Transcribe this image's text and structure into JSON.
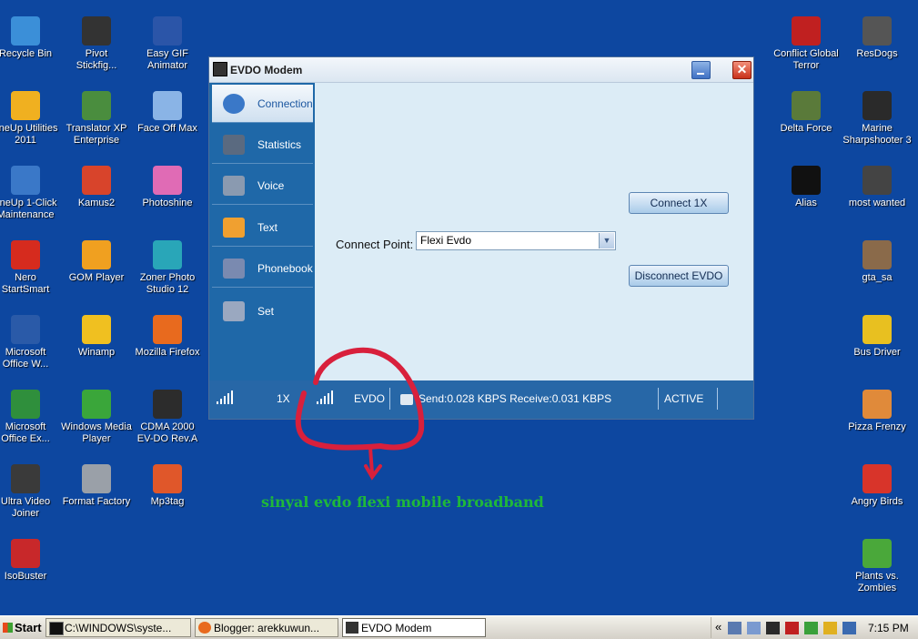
{
  "desktop_left": [
    {
      "label": "Recycle Bin",
      "icon": "recycle-bin-icon",
      "color": "#3b8fd8"
    },
    {
      "label": "Pivot\nStickfig...",
      "icon": "stick-figure-icon",
      "color": "#333333"
    },
    {
      "label": "Easy GIF\nAnimator",
      "icon": "film-icon",
      "color": "#2b55a8"
    },
    {
      "label": "uneUp Utilities\n2011",
      "icon": "tuneup-icon",
      "color": "#f0b020"
    },
    {
      "label": "Translator XP\nEnterprise",
      "icon": "globe-icon",
      "color": "#4a8d3e"
    },
    {
      "label": "Face Off Max",
      "icon": "face-off-icon",
      "color": "#8ab4e6"
    },
    {
      "label": "uneUp 1-Click\nMaintenance",
      "icon": "computer-icon",
      "color": "#3a78c8"
    },
    {
      "label": "Kamus2",
      "icon": "book-icon",
      "color": "#d8442b"
    },
    {
      "label": "Photoshine",
      "icon": "photoshine-icon",
      "color": "#e06bb5"
    },
    {
      "label": "Nero\nStartSmart",
      "icon": "nero-icon",
      "color": "#d62b1e"
    },
    {
      "label": "GOM Player",
      "icon": "gom-icon",
      "color": "#f0a020"
    },
    {
      "label": "Zoner Photo\nStudio 12",
      "icon": "zoner-icon",
      "color": "#29a6b8"
    },
    {
      "label": "Microsoft\nOffice W...",
      "icon": "word-icon",
      "color": "#2a5aa8"
    },
    {
      "label": "Winamp",
      "icon": "winamp-icon",
      "color": "#f0c020"
    },
    {
      "label": "Mozilla Firefox",
      "icon": "firefox-icon",
      "color": "#e86a1e"
    },
    {
      "label": "Microsoft\nOffice Ex...",
      "icon": "excel-icon",
      "color": "#2f8f3c"
    },
    {
      "label": "Windows Media\nPlayer",
      "icon": "media-player-icon",
      "color": "#3aa63a"
    },
    {
      "label": "CDMA 2000\nEV-DO Rev.A",
      "icon": "cdma-icon",
      "color": "#2c2c2c"
    },
    {
      "label": "Ultra Video\nJoiner",
      "icon": "video-joiner-icon",
      "color": "#3a3a3a"
    },
    {
      "label": "Format Factory",
      "icon": "format-factory-icon",
      "color": "#9aa0a8"
    },
    {
      "label": "Mp3tag",
      "icon": "mp3tag-icon",
      "color": "#e0572a"
    },
    {
      "label": "IsoBuster",
      "icon": "isobuster-icon",
      "color": "#c8282a"
    }
  ],
  "desktop_right": [
    {
      "label": "Conflict Global\nTerror",
      "icon": "conflict-icon",
      "color": "#c02020"
    },
    {
      "label": "ResDogs",
      "icon": "resdogs-icon",
      "color": "#555555"
    },
    {
      "label": "Delta Force",
      "icon": "delta-force-icon",
      "color": "#5a7a3a"
    },
    {
      "label": "Marine\nSharpshooter 3",
      "icon": "marine-icon",
      "color": "#2a2a2a"
    },
    {
      "label": "Alias",
      "icon": "alias-icon",
      "color": "#111111"
    },
    {
      "label": "most wanted",
      "icon": "nfs-icon",
      "color": "#444444"
    },
    {
      "label": "gta_sa",
      "icon": "gta-icon",
      "color": "#8a6a4a"
    },
    {
      "label": "Bus Driver",
      "icon": "bus-icon",
      "color": "#e8c020"
    },
    {
      "label": "Pizza Frenzy",
      "icon": "pizza-icon",
      "color": "#e08a3a"
    },
    {
      "label": "Angry Birds",
      "icon": "angry-birds-icon",
      "color": "#d8342a"
    },
    {
      "label": "Plants vs.\nZombies",
      "icon": "plants-icon",
      "color": "#4aa83a"
    }
  ],
  "window": {
    "title": "EVDO Modem",
    "nav": [
      {
        "label": "Connection",
        "icon": "connection-icon",
        "color": "#3a78c8"
      },
      {
        "label": "Statistics",
        "icon": "chart-icon",
        "color": "#5a6a80"
      },
      {
        "label": "Voice",
        "icon": "phone-icon",
        "color": "#8a9ab0"
      },
      {
        "label": "Text",
        "icon": "envelope-icon",
        "color": "#f0a030"
      },
      {
        "label": "Phonebook",
        "icon": "phonebook-icon",
        "color": "#7a8ab0"
      },
      {
        "label": "Set",
        "icon": "settings-icon",
        "color": "#9aa8c0"
      }
    ],
    "connect_1x": "Connect 1X",
    "disconnect_evdo": "Disconnect EVDO",
    "connect_point_label": "Connect Point:",
    "connect_point_value": "Flexi Evdo",
    "status": {
      "mode1": "1X",
      "mode2": "EVDO",
      "traffic": "Send:0.028 KBPS Receive:0.031 KBPS",
      "state": "ACTIVE"
    }
  },
  "annotation": "sinyal evdo flexi mobile broadband",
  "colors": {
    "desktop": "#0d47a0",
    "annotation_circle": "#d8203c",
    "annotation_text": "#1fb83a"
  },
  "taskbar": {
    "start": "Start",
    "tasks": [
      {
        "label": "C:\\WINDOWS\\syste...",
        "icon": "cmd-icon"
      },
      {
        "label": "Blogger: arekkuwun...",
        "icon": "firefox-icon"
      },
      {
        "label": "EVDO Modem",
        "icon": "evdo-app-icon"
      }
    ],
    "tray_expand": "«",
    "clock": "7:15 PM"
  }
}
